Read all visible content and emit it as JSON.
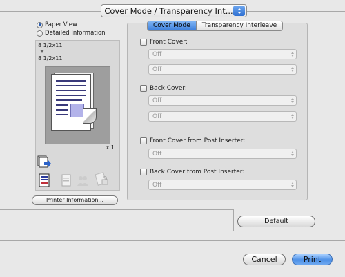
{
  "header": {
    "popup_label": "Cover Mode / Transparency Int..."
  },
  "view_options": {
    "paper_view": "Paper View",
    "detailed_info": "Detailed Information"
  },
  "paper": {
    "size_top": "8 1/2x11",
    "size_bottom": "8 1/2x11",
    "copies": "x 1"
  },
  "left": {
    "printer_info_label": "Printer Information..."
  },
  "tabs": {
    "cover_mode": "Cover Mode",
    "transparency": "Transparency Interleave"
  },
  "cover": {
    "front_label": "Front Cover:",
    "front_sel1": "Off",
    "front_sel2": "Off",
    "back_label": "Back Cover:",
    "back_sel1": "Off",
    "back_sel2": "Off",
    "front_post_label": "Front Cover from Post Inserter:",
    "front_post_sel": "Off",
    "back_post_label": "Back Cover from Post Inserter:",
    "back_post_sel": "Off"
  },
  "buttons": {
    "default": "Default",
    "cancel": "Cancel",
    "print": "Print"
  },
  "icons": [
    "booklet-arrow-icon",
    "document-icon",
    "duplex-icon",
    "people-icon",
    "lock-icon"
  ],
  "colors": {
    "accent": "#3c7fdb",
    "paper_block": "#b3b3ea"
  }
}
